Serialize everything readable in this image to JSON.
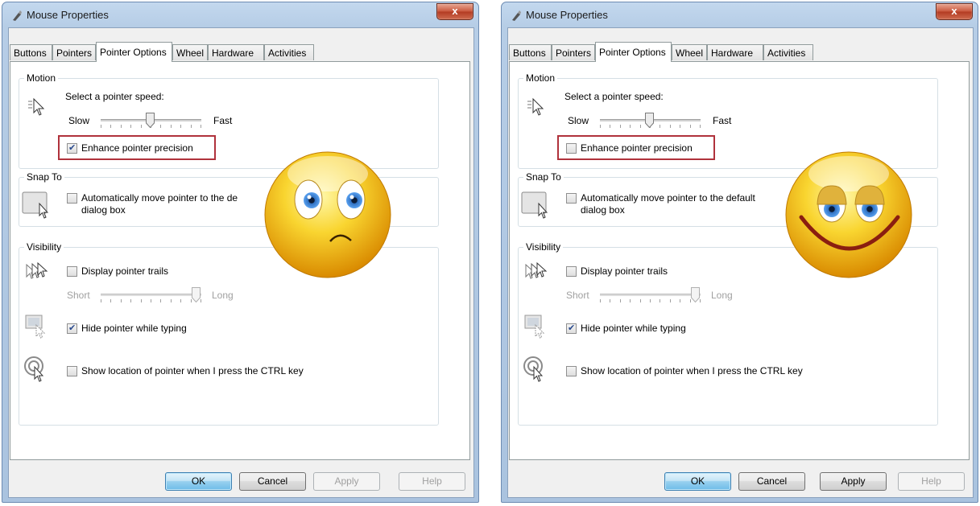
{
  "windows": [
    {
      "side": "left",
      "title": "Mouse Properties",
      "close_label": "x",
      "tabs": [
        "Buttons",
        "Pointers",
        "Pointer Options",
        "Wheel",
        "Hardware",
        "Activities"
      ],
      "active_tab": "Pointer Options",
      "motion": {
        "group_label": "Motion",
        "speed_label": "Select a pointer speed:",
        "slow_label": "Slow",
        "fast_label": "Fast",
        "speed_level": 0.5,
        "enhance_label": "Enhance pointer precision",
        "enhance_checked": true
      },
      "snap_to": {
        "group_label": "Snap To",
        "line1": "Automatically move pointer to the de",
        "line2": "dialog box",
        "checked": false
      },
      "visibility": {
        "group_label": "Visibility",
        "trails_label": "Display pointer trails",
        "trails_checked": false,
        "short_label": "Short",
        "long_label": "Long",
        "trail_level": 1.0,
        "hide_label": "Hide pointer while typing",
        "hide_checked": true,
        "ctrl_label": "Show location of pointer when I press the CTRL key",
        "ctrl_checked": false
      },
      "buttons": {
        "ok": "OK",
        "cancel": "Cancel",
        "apply": "Apply",
        "help": "Help"
      },
      "apply_enabled": false,
      "smiley": "sad-smiley"
    },
    {
      "side": "right",
      "title": "Mouse Properties",
      "close_label": "x",
      "tabs": [
        "Buttons",
        "Pointers",
        "Pointer Options",
        "Wheel",
        "Hardware",
        "Activities"
      ],
      "active_tab": "Pointer Options",
      "motion": {
        "group_label": "Motion",
        "speed_label": "Select a pointer speed:",
        "slow_label": "Slow",
        "fast_label": "Fast",
        "speed_level": 0.5,
        "enhance_label": "Enhance pointer precision",
        "enhance_checked": false
      },
      "snap_to": {
        "group_label": "Snap To",
        "line1": "Automatically move pointer to the default",
        "line2": "dialog box",
        "checked": false
      },
      "visibility": {
        "group_label": "Visibility",
        "trails_label": "Display pointer trails",
        "trails_checked": false,
        "short_label": "Short",
        "long_label": "Long",
        "trail_level": 1.0,
        "hide_label": "Hide pointer while typing",
        "hide_checked": true,
        "ctrl_label": "Show location of pointer when I press the CTRL key",
        "ctrl_checked": false
      },
      "buttons": {
        "ok": "OK",
        "cancel": "Cancel",
        "apply": "Apply",
        "help": "Help"
      },
      "apply_enabled": true,
      "smiley": "happy-smiley"
    }
  ],
  "colors": {
    "highlight_border": "#b0323c",
    "smiley_yellow": "#f7c81e",
    "eye_blue": "#2f6fc0"
  }
}
